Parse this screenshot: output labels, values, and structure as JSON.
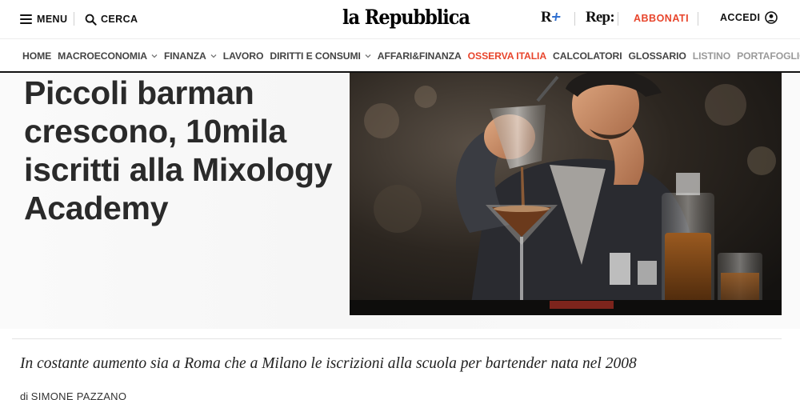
{
  "header": {
    "menu_label": "MENU",
    "search_label": "CERCA",
    "logo_text": "la Repubblica",
    "rplus_label": "R",
    "rep_label": "Rep:",
    "subscribe_label": "ABBONATI",
    "login_label": "ACCEDI",
    "accent_color": "#e8452c"
  },
  "nav": {
    "items": [
      {
        "label": "HOME",
        "has_dropdown": false,
        "style": "normal"
      },
      {
        "label": "MACROECONOMIA",
        "has_dropdown": true,
        "style": "normal"
      },
      {
        "label": "FINANZA",
        "has_dropdown": true,
        "style": "normal"
      },
      {
        "label": "LAVORO",
        "has_dropdown": false,
        "style": "normal"
      },
      {
        "label": "DIRITTI E CONSUMI",
        "has_dropdown": true,
        "style": "normal"
      },
      {
        "label": "AFFARI&FINANZA",
        "has_dropdown": false,
        "style": "normal"
      },
      {
        "label": "OSSERVA ITALIA",
        "has_dropdown": false,
        "style": "accent"
      },
      {
        "label": "CALCOLATORI",
        "has_dropdown": false,
        "style": "normal"
      },
      {
        "label": "GLOSSARIO",
        "has_dropdown": false,
        "style": "normal"
      },
      {
        "label": "LISTINO",
        "has_dropdown": false,
        "style": "muted"
      },
      {
        "label": "PORTAFOGLIO",
        "has_dropdown": false,
        "style": "muted"
      }
    ]
  },
  "article": {
    "headline": "Piccoli barman crescono, 10mila iscritti alla Mixology Academy",
    "image_subject": "bartender-pouring-cocktail-photo",
    "subtitle": "In costante aumento sia a Roma che a Milano le iscrizioni alla scuola per bartender nata nel 2008",
    "byline_prefix": "di",
    "author": "Simone Pazzano"
  }
}
